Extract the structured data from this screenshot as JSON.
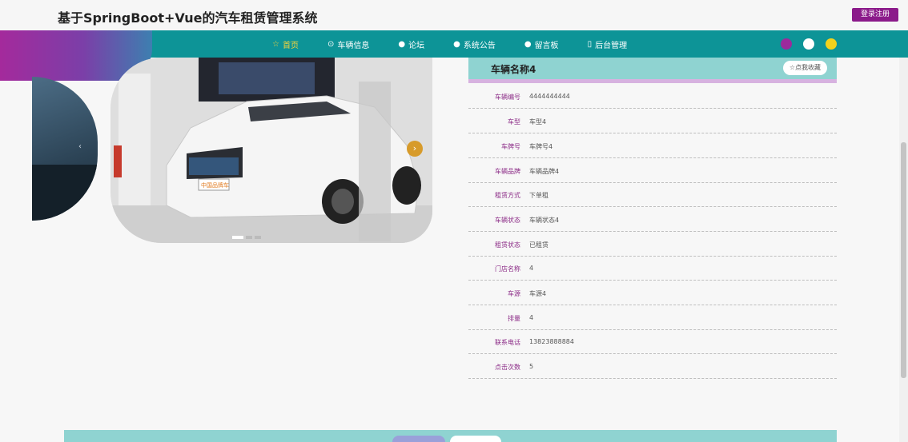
{
  "header": {
    "title": "基于SpringBoot+Vue的汽车租赁管理系统",
    "login_label": "登录注册"
  },
  "nav": {
    "items": [
      {
        "label": "首页",
        "icon": "star-icon",
        "active": true
      },
      {
        "label": "车辆信息",
        "icon": "car-icon",
        "active": false
      },
      {
        "label": "论坛",
        "icon": "dot-icon",
        "active": false
      },
      {
        "label": "系统公告",
        "icon": "dot-icon",
        "active": false
      },
      {
        "label": "留言板",
        "icon": "dot-icon",
        "active": false
      },
      {
        "label": "后台管理",
        "icon": "admin-icon",
        "active": false
      }
    ],
    "theme_colors": [
      "#9c2a9c",
      "#ffffff",
      "#f2d21c"
    ]
  },
  "detail": {
    "title": "车辆名称4",
    "fav_label": "☆点我收藏",
    "fields": [
      {
        "label": "车辆编号",
        "value": "4444444444"
      },
      {
        "label": "车型",
        "value": "车型4"
      },
      {
        "label": "车牌号",
        "value": "车牌号4"
      },
      {
        "label": "车辆品牌",
        "value": "车辆品牌4"
      },
      {
        "label": "租赁方式",
        "value": "下单租"
      },
      {
        "label": "车辆状态",
        "value": "车辆状态4"
      },
      {
        "label": "租赁状态",
        "value": "已租赁"
      },
      {
        "label": "门店名称",
        "value": "4"
      },
      {
        "label": "车源",
        "value": "车源4"
      },
      {
        "label": "排量",
        "value": "4"
      },
      {
        "label": "联系电话",
        "value": "13823888884"
      },
      {
        "label": "点击次数",
        "value": "5"
      }
    ]
  },
  "carousel": {
    "plate_text": "中国品牌车",
    "slides": 3,
    "active_slide": 1
  },
  "colors": {
    "nav_teal": "#0d9497",
    "accent_purple": "#8b1a8a",
    "header_mint": "#8fd3d1",
    "active_nav": "#f2d23c"
  }
}
